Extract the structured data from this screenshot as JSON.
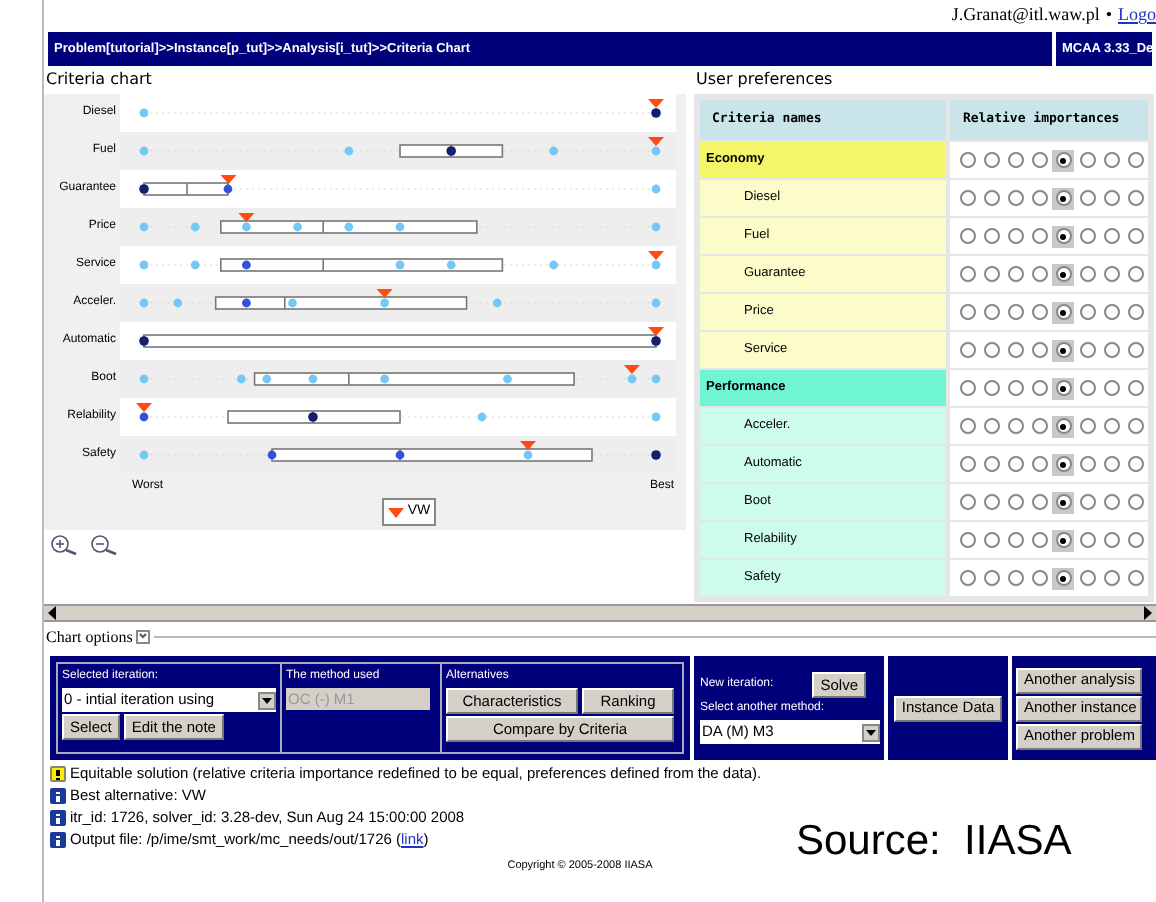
{
  "top_bar": {
    "user": "J.Granat@itl.waw.pl",
    "separator": "•",
    "logout": "Logo"
  },
  "breadcrumb": "Problem[tutorial]>>Instance[p_tut]>>Analysis[i_tut]>>Criteria Chart",
  "version": "MCAA 3.33_De",
  "criteria_chart": {
    "title": "Criteria chart",
    "rows": [
      "Diesel",
      "Fuel",
      "Guarantee",
      "Price",
      "Service",
      "Acceler.",
      "Automatic",
      "Boot",
      "Relability",
      "Safety"
    ],
    "axis_start": "Worst",
    "axis_end": "Best",
    "legend": "VW"
  },
  "preferences": {
    "title": "User preferences",
    "columns": [
      "Criteria names",
      "Relative importances"
    ],
    "groups": [
      {
        "name": "Economy",
        "color": "#f5f56a",
        "importances": [
          {
            "selected": false
          },
          {
            "selected": false
          },
          {
            "selected": false
          },
          {
            "selected": false
          },
          {
            "selected": true
          },
          {
            "selected": false
          },
          {
            "selected": false
          },
          {
            "selected": false
          }
        ],
        "children": [
          {
            "name": "Diesel",
            "importances": [
              {
                "selected": false
              },
              {
                "selected": false
              },
              {
                "selected": false
              },
              {
                "selected": false
              },
              {
                "selected": true
              },
              {
                "selected": false
              },
              {
                "selected": false
              },
              {
                "selected": false
              }
            ]
          },
          {
            "name": "Fuel",
            "importances": [
              {
                "selected": false
              },
              {
                "selected": false
              },
              {
                "selected": false
              },
              {
                "selected": false
              },
              {
                "selected": true
              },
              {
                "selected": false
              },
              {
                "selected": false
              },
              {
                "selected": false
              }
            ]
          },
          {
            "name": "Guarantee",
            "importances": [
              {
                "selected": false
              },
              {
                "selected": false
              },
              {
                "selected": false
              },
              {
                "selected": false
              },
              {
                "selected": true
              },
              {
                "selected": false
              },
              {
                "selected": false
              },
              {
                "selected": false
              }
            ]
          },
          {
            "name": "Price",
            "importances": [
              {
                "selected": false
              },
              {
                "selected": false
              },
              {
                "selected": false
              },
              {
                "selected": false
              },
              {
                "selected": true
              },
              {
                "selected": false
              },
              {
                "selected": false
              },
              {
                "selected": false
              }
            ]
          },
          {
            "name": "Service",
            "importances": [
              {
                "selected": false
              },
              {
                "selected": false
              },
              {
                "selected": false
              },
              {
                "selected": false
              },
              {
                "selected": true
              },
              {
                "selected": false
              },
              {
                "selected": false
              },
              {
                "selected": false
              }
            ]
          }
        ]
      },
      {
        "name": "Performance",
        "color": "#6ff5d2",
        "importances": [
          {
            "selected": false
          },
          {
            "selected": false
          },
          {
            "selected": false
          },
          {
            "selected": false
          },
          {
            "selected": true
          },
          {
            "selected": false
          },
          {
            "selected": false
          },
          {
            "selected": false
          }
        ],
        "children": [
          {
            "name": "Acceler.",
            "importances": [
              {
                "selected": false
              },
              {
                "selected": false
              },
              {
                "selected": false
              },
              {
                "selected": false
              },
              {
                "selected": true
              },
              {
                "selected": false
              },
              {
                "selected": false
              },
              {
                "selected": false
              }
            ]
          },
          {
            "name": "Automatic",
            "importances": [
              {
                "selected": false
              },
              {
                "selected": false
              },
              {
                "selected": false
              },
              {
                "selected": false
              },
              {
                "selected": true
              },
              {
                "selected": false
              },
              {
                "selected": false
              },
              {
                "selected": false
              }
            ]
          },
          {
            "name": "Boot",
            "importances": [
              {
                "selected": false
              },
              {
                "selected": false
              },
              {
                "selected": false
              },
              {
                "selected": false
              },
              {
                "selected": true
              },
              {
                "selected": false
              },
              {
                "selected": false
              },
              {
                "selected": false
              }
            ]
          },
          {
            "name": "Relability",
            "importances": [
              {
                "selected": false
              },
              {
                "selected": false
              },
              {
                "selected": false
              },
              {
                "selected": false
              },
              {
                "selected": true
              },
              {
                "selected": false
              },
              {
                "selected": false
              },
              {
                "selected": false
              }
            ]
          },
          {
            "name": "Safety",
            "importances": [
              {
                "selected": false
              },
              {
                "selected": false
              },
              {
                "selected": false
              },
              {
                "selected": false
              },
              {
                "selected": true
              },
              {
                "selected": false
              },
              {
                "selected": false
              },
              {
                "selected": false
              }
            ]
          }
        ]
      }
    ]
  },
  "chart_options": "Chart options",
  "controls": {
    "selected_iteration_label": "Selected iteration:",
    "iteration_value": "0 - intial iteration using",
    "select_button": "Select",
    "edit_note_button": "Edit the note",
    "method_used_label": "The method used",
    "method_used_value": "OC (-) M1",
    "alternatives_label": "Alternatives",
    "characteristics_button": "Characteristics",
    "ranking_button": "Ranking",
    "compare_button": "Compare by Criteria",
    "new_iteration_label": "New iteration:",
    "solve_button": "Solve",
    "another_method_label": "Select another method:",
    "method_value": "DA (M) M3",
    "instance_data_button": "Instance Data",
    "navigation_buttons": [
      "Another analysis",
      "Another instance",
      "Another problem"
    ]
  },
  "messages": [
    {
      "kind": "warning",
      "text": "Equitable solution (relative criteria importance redefined to be equal, preferences defined from the data)."
    },
    {
      "kind": "info",
      "text": "Best alternative: VW"
    },
    {
      "kind": "info",
      "text": "itr_id: 1726, solver_id: 3.28-dev, Sun Aug 24 15:00:00 2008"
    },
    {
      "kind": "info",
      "text": "Output file: /p/ime/smt_work/mc_needs/out/1726 (",
      "link": "link",
      "after": ")"
    }
  ],
  "copyright": "Copyright © 2005-2008 IIASA",
  "source_caption": "Source:  IIASA"
}
